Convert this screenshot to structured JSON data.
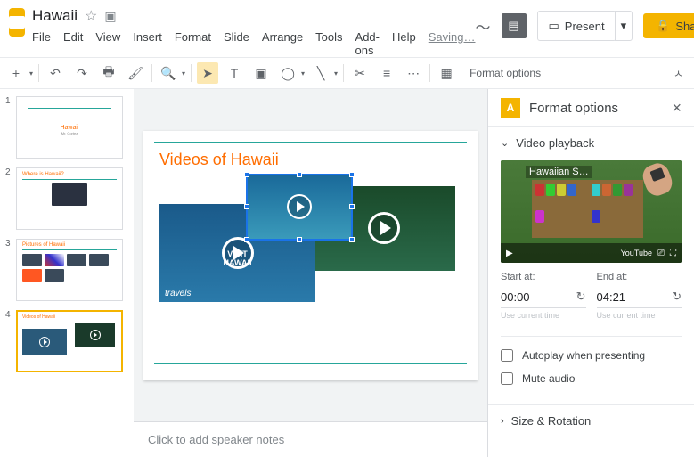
{
  "header": {
    "doc_title": "Hawaii",
    "menubar": [
      "File",
      "Edit",
      "View",
      "Insert",
      "Format",
      "Slide",
      "Arrange",
      "Tools",
      "Add-ons",
      "Help"
    ],
    "saving": "Saving…",
    "present": "Present",
    "share": "Share"
  },
  "toolbar": {
    "format_options": "Format options"
  },
  "filmstrip": {
    "slides": [
      {
        "num": "1",
        "title": "Hawaii",
        "sub": "Mr. Cortez"
      },
      {
        "num": "2",
        "title": "Where is Hawaii?"
      },
      {
        "num": "3",
        "title": "Pictures of Hawaii"
      },
      {
        "num": "4",
        "title": "Videos of Hawaii"
      }
    ]
  },
  "canvas": {
    "slide_title": "Videos of Hawaii",
    "video1_line1": "VISIT",
    "video1_line2": "HAWAII",
    "video1_sub": "travels",
    "speaker_notes_placeholder": "Click to add speaker notes"
  },
  "sidebar": {
    "title": "Format options",
    "section_playback": "Video playback",
    "preview_title": "Hawaiian S…",
    "preview_youtube": "YouTube",
    "start_label": "Start at:",
    "end_label": "End at:",
    "start_value": "00:00",
    "end_value": "04:21",
    "use_current": "Use current time",
    "autoplay": "Autoplay when presenting",
    "mute": "Mute audio",
    "section_size": "Size & Rotation"
  }
}
